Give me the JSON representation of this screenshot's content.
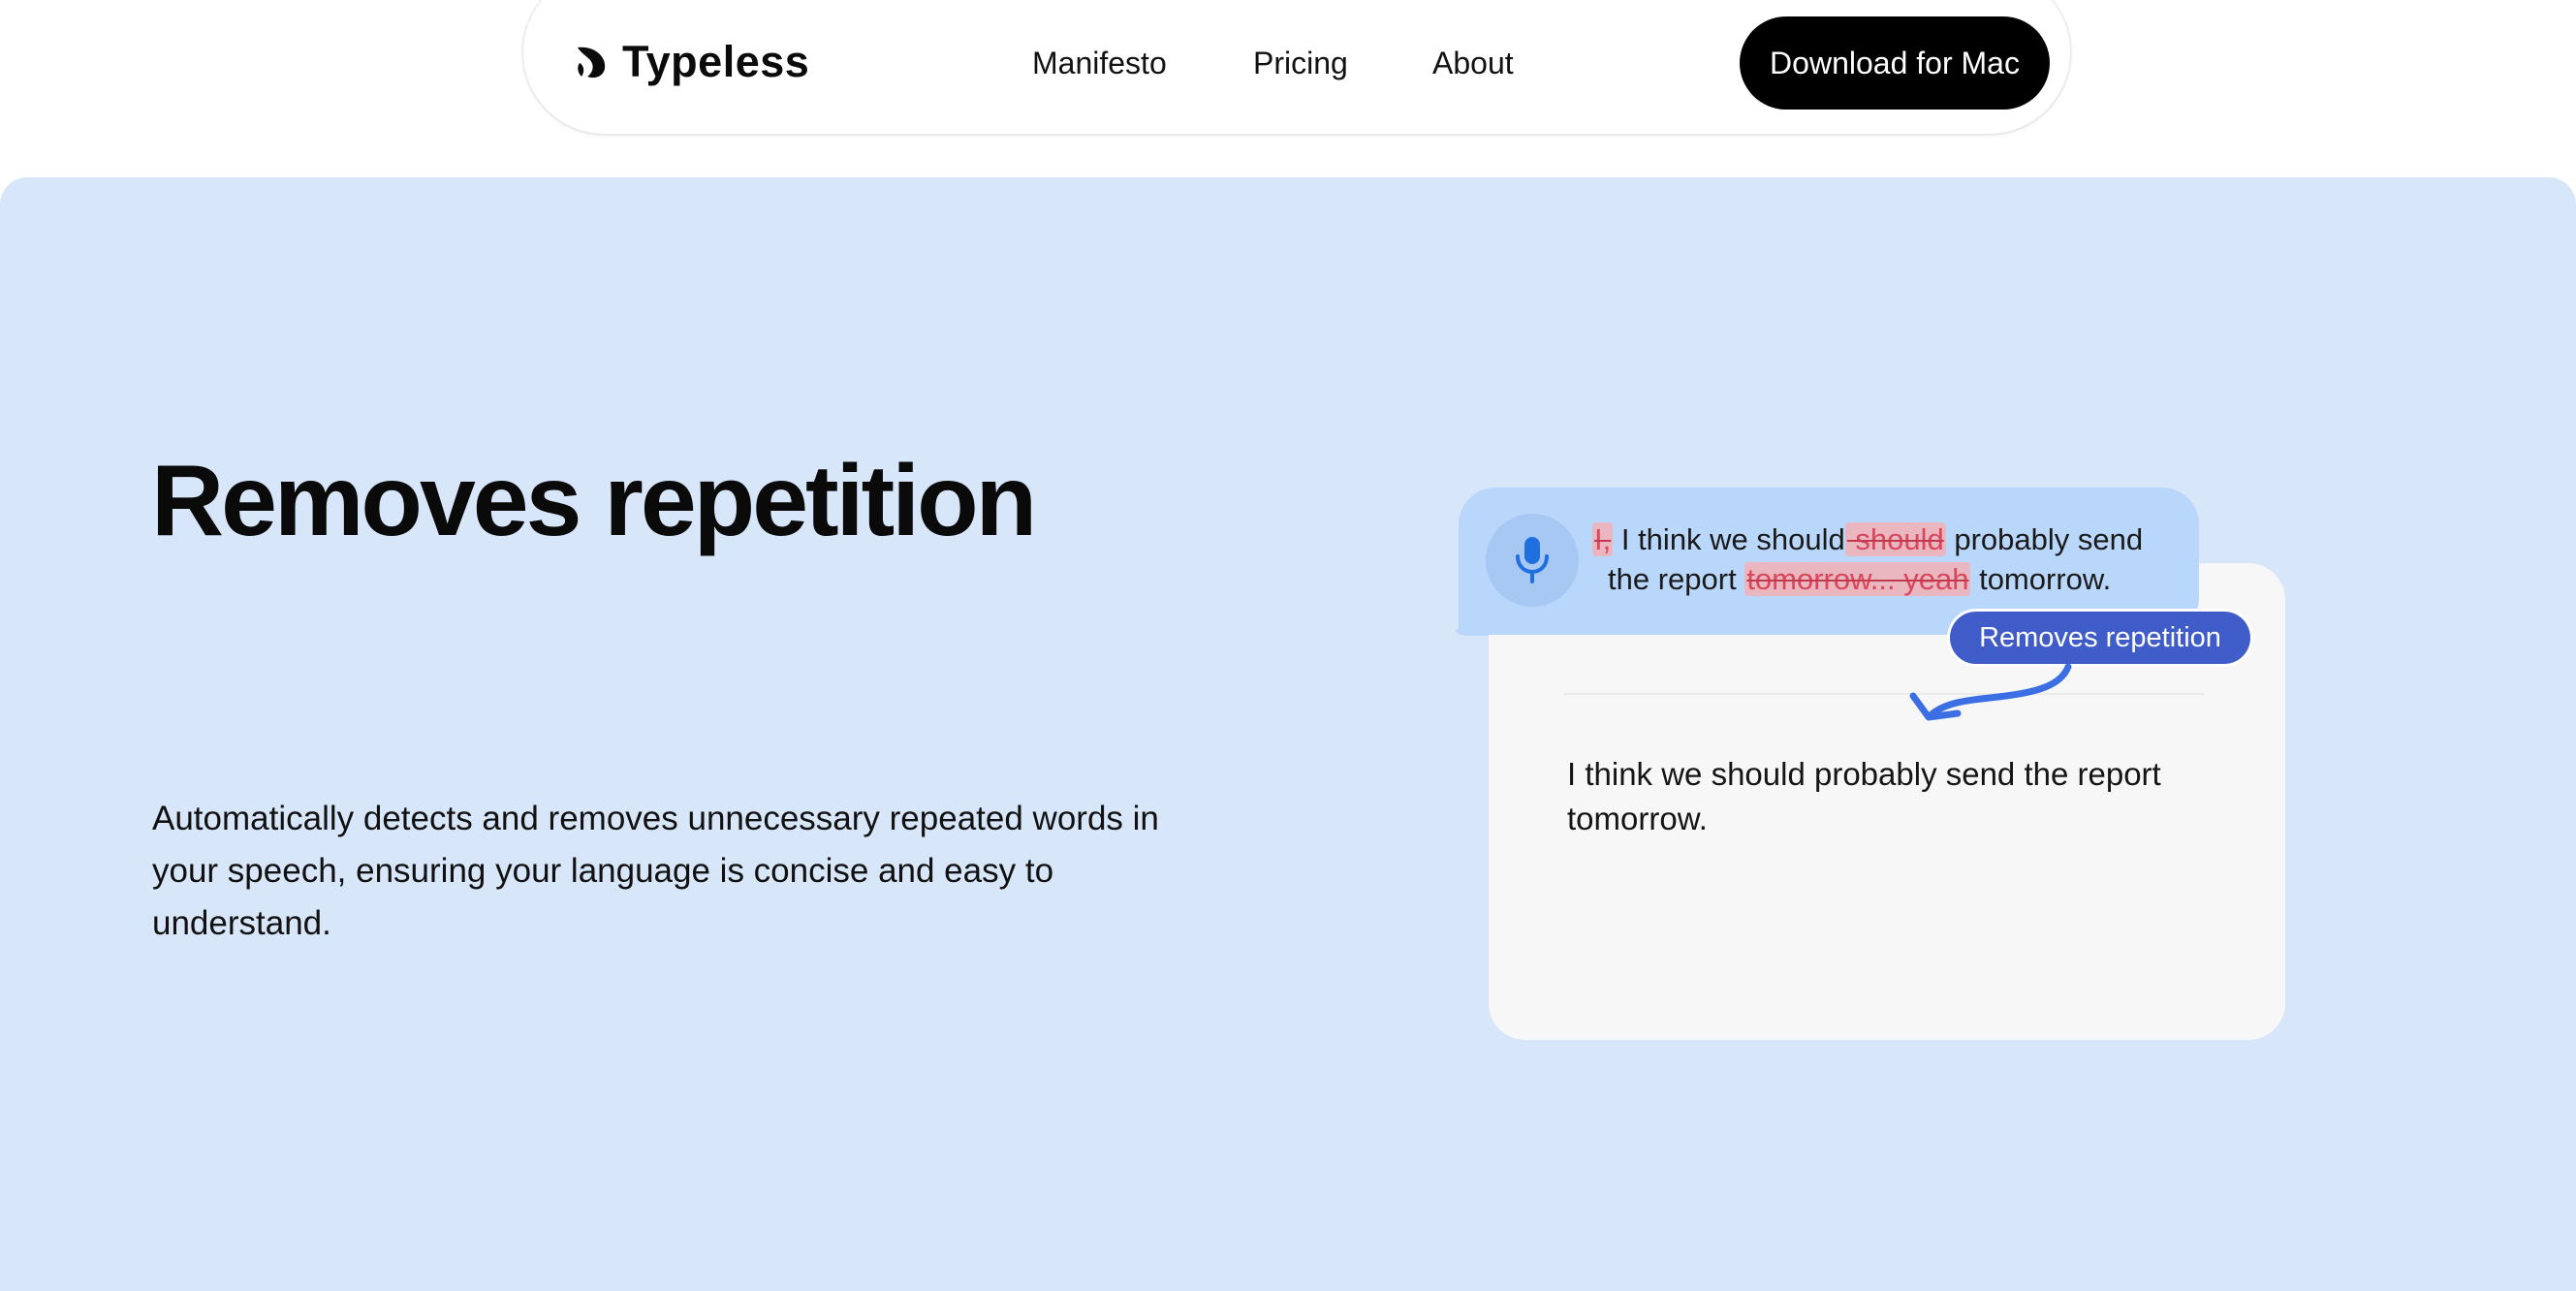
{
  "nav": {
    "logo_text": "Typeless",
    "links": [
      "Manifesto",
      "Pricing",
      "About"
    ],
    "cta_label": "Download for Mac"
  },
  "hero": {
    "title": "Removes repetition",
    "description": "Automatically detects and removes unnecessary repeated words in your speech, ensuring your language is concise and easy to understand."
  },
  "demo": {
    "mic_icon": "microphone-icon",
    "transcript": {
      "del_1": "I,",
      "seg_1": " I think we should",
      "del_2": " should",
      "seg_2": " probably send",
      "seg_3": "the report ",
      "del_3": "tomorrow... yeah",
      "seg_4": " tomorrow."
    },
    "tag_label": "Removes repetition",
    "output_text": "I think we should probably send the report tomorrow."
  },
  "colors": {
    "hero_bg": "#d8e6f9",
    "bubble_bg": "#b9d6fb",
    "tag_bg": "#3f5cc9",
    "deleted_bg": "#eab6c0",
    "deleted_text": "#d9475b",
    "accent_blue": "#1f6fe0",
    "cta_bg": "#000000"
  }
}
